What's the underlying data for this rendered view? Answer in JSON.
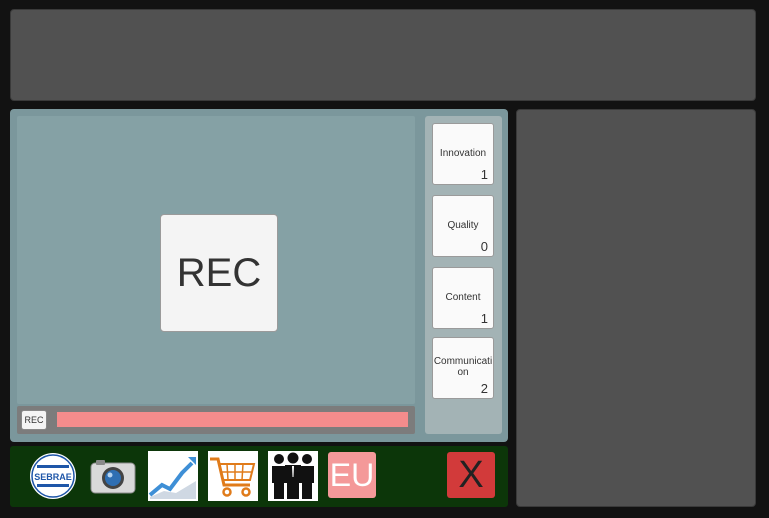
{
  "recorder": {
    "main_button_label": "REC",
    "small_button_label": "REC"
  },
  "scores": [
    {
      "label": "Innovation",
      "value": "1"
    },
    {
      "label": "Quality",
      "value": "0"
    },
    {
      "label": "Content",
      "value": "1"
    },
    {
      "label": "Communicati on",
      "value": "2"
    }
  ],
  "toolbar": {
    "sebrae_logo_text": "SEBRAE",
    "icons": [
      "sebrae-logo-icon",
      "camera-icon",
      "growth-chart-icon",
      "shopping-cart-icon",
      "team-icon"
    ],
    "eu_label": "EU",
    "close_label": "X"
  },
  "colors": {
    "progress_bar": "#f48c8c",
    "toolbar_background": "#0c3609",
    "close_button": "#d23a3a",
    "eu_button": "#f49999"
  }
}
